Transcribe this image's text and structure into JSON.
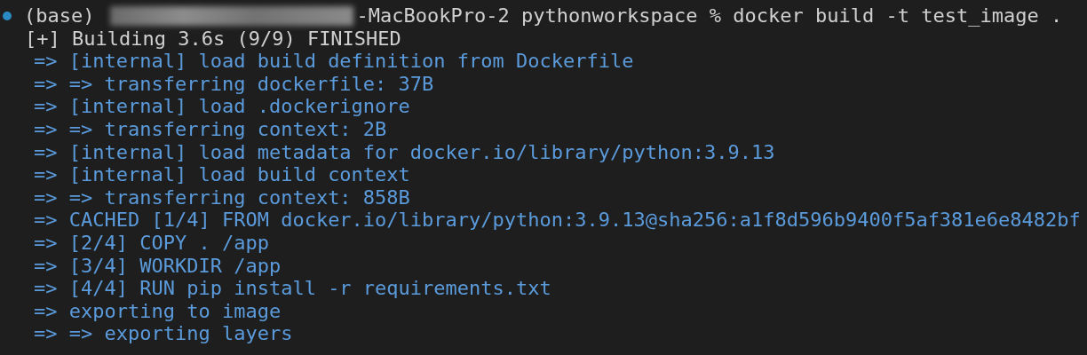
{
  "prompt": {
    "env": "(base)",
    "redacted": true,
    "command": "-MacBookPro-2 pythonworkspace % docker build -t test_image ."
  },
  "build_header": "[+] Building 3.6s (9/9) FINISHED",
  "steps": [
    "=> [internal] load build definition from Dockerfile",
    "=> => transferring dockerfile: 37B",
    "=> [internal] load .dockerignore",
    "=> => transferring context: 2B",
    "=> [internal] load metadata for docker.io/library/python:3.9.13",
    "=> [internal] load build context",
    "=> => transferring context: 858B",
    "=> CACHED [1/4] FROM docker.io/library/python:3.9.13@sha256:a1f8d596b9400f5af381e6e8482bf",
    "=> [2/4] COPY . /app",
    "=> [3/4] WORKDIR /app",
    "=> [4/4] RUN pip install -r requirements.txt",
    "=> exporting to image",
    "=> => exporting layers"
  ]
}
